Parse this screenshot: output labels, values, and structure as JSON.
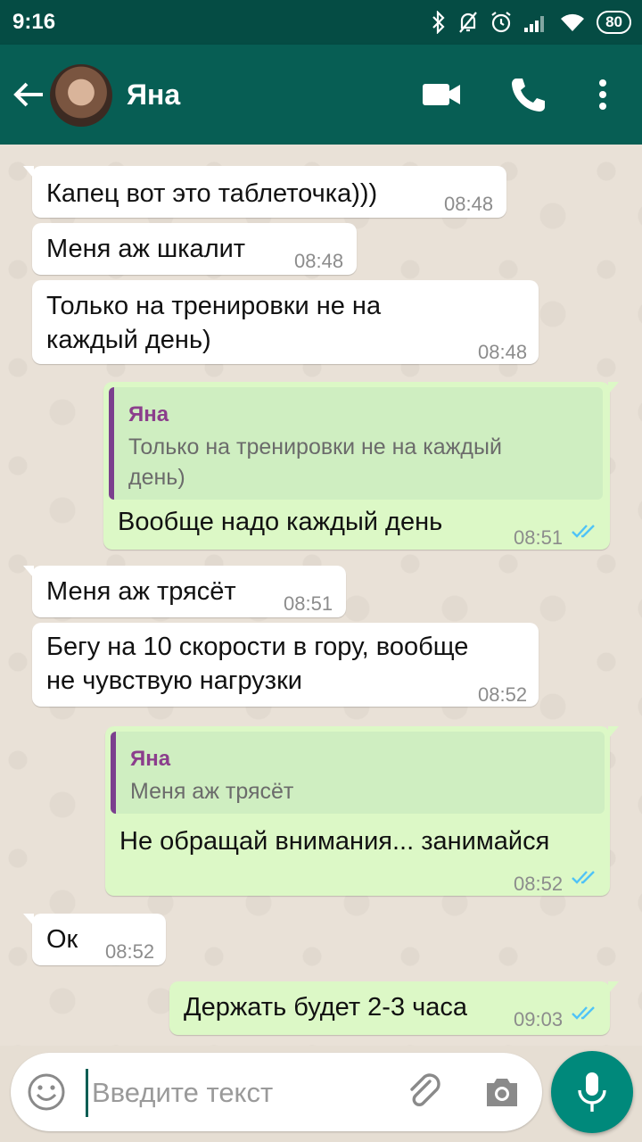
{
  "status": {
    "time": "9:16",
    "battery": "80"
  },
  "header": {
    "contact_name": "Яна"
  },
  "messages": [
    {
      "dir": "in",
      "text": "Капец вот это таблеточка)))",
      "time": "08:48"
    },
    {
      "dir": "in",
      "text": "Меня аж шкалит",
      "time": "08:48"
    },
    {
      "dir": "in",
      "text_line1": "Только на тренировки не на",
      "text_line2": "каждый день)",
      "time": "08:48"
    },
    {
      "dir": "out",
      "reply_name": "Яна",
      "reply_line1": "Только на тренировки не на каждый",
      "reply_line2": "день)",
      "text": "Вообще надо каждый день",
      "time": "08:51"
    },
    {
      "dir": "in",
      "text": "Меня аж трясёт",
      "time": "08:51"
    },
    {
      "dir": "in",
      "text_line1": "Бегу на 10 скорости в гору, вообще",
      "text_line2": "не чувствую нагрузки",
      "time": "08:52"
    },
    {
      "dir": "out",
      "reply_name": "Яна",
      "reply_text": "Меня аж трясёт",
      "text": "Не обращай внимания... занимайся",
      "time": "08:52"
    },
    {
      "dir": "in",
      "text": "Ок",
      "time": "08:52"
    },
    {
      "dir": "out",
      "text": "Держать будет 2-3 часа",
      "time": "09:03"
    }
  ],
  "composer": {
    "placeholder": "Введите текст"
  },
  "colors": {
    "header": "#075e54",
    "statusbar": "#054c44",
    "outgoing": "#dcf8c6",
    "incoming": "#ffffff",
    "tick": "#4fc3f7",
    "fab": "#00897b"
  },
  "icons": [
    "back-arrow-icon",
    "video-call-icon",
    "phone-icon",
    "more-vert-icon",
    "emoji-icon",
    "attach-icon",
    "camera-icon",
    "mic-icon",
    "read-ticks-icon"
  ]
}
